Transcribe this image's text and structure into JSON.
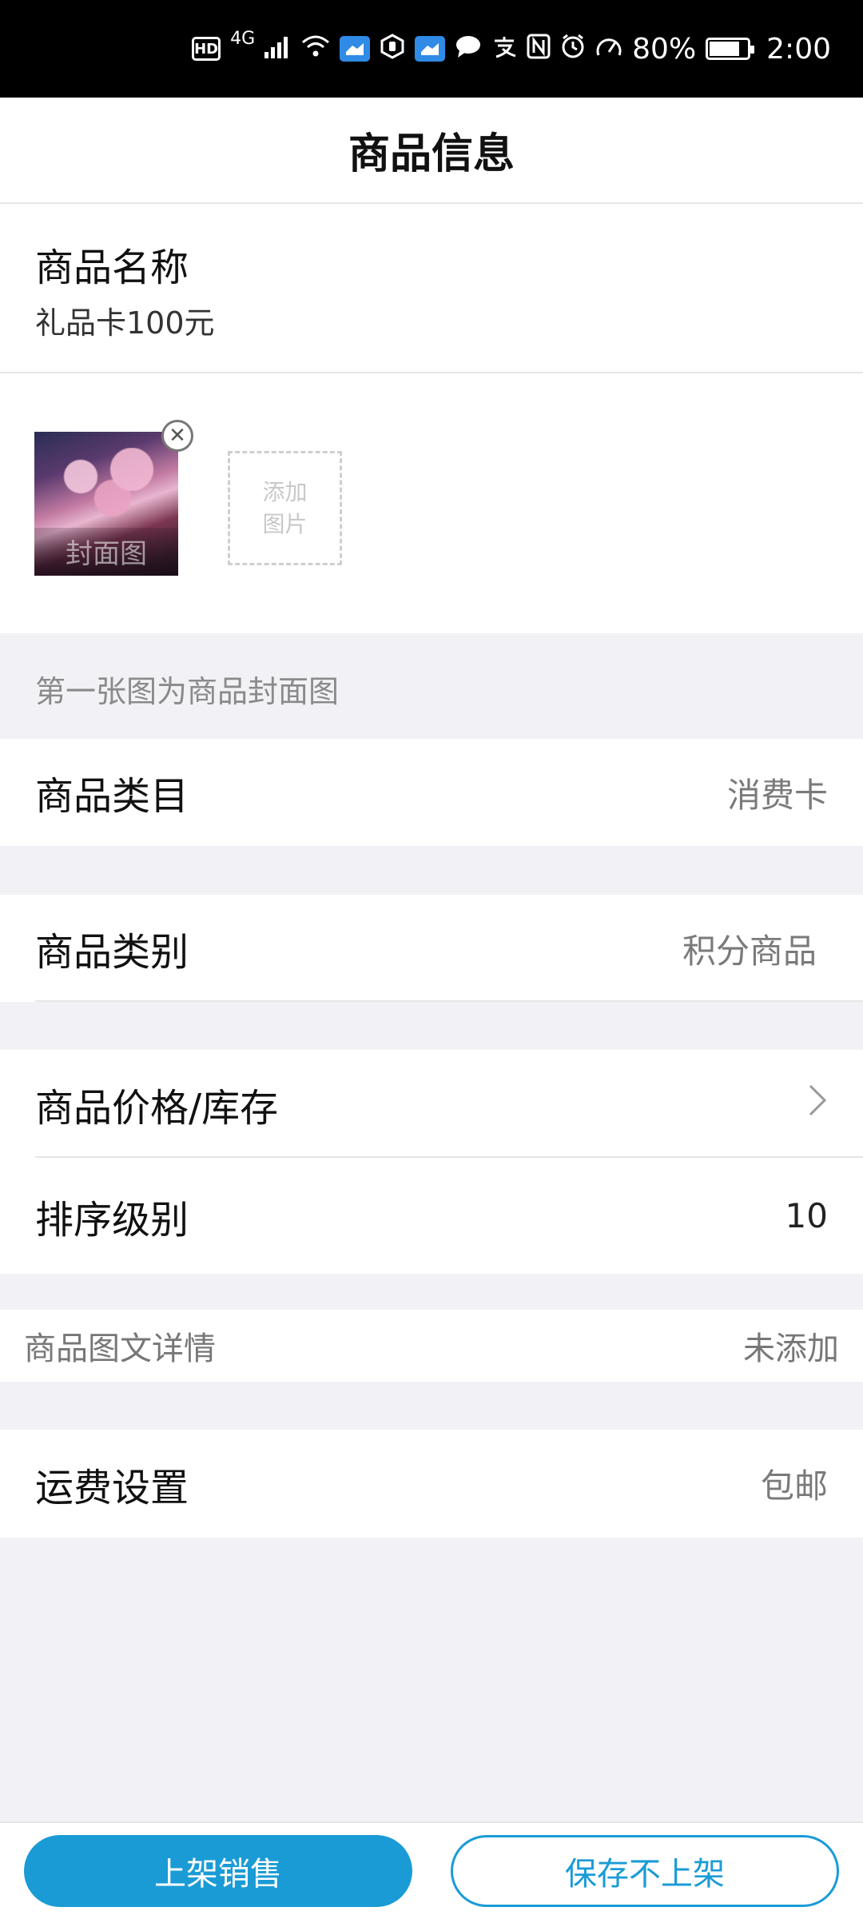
{
  "status_bar": {
    "hd": "HD",
    "network": "4G",
    "battery_percent": "80%",
    "battery_level": 0.8,
    "time": "2:00"
  },
  "nav": {
    "title": "商品信息"
  },
  "product_name": {
    "label": "商品名称",
    "value": "礼品卡100元"
  },
  "images": {
    "cover_caption": "封面图",
    "remove_icon": "close-circle-icon",
    "add_line1": "添加",
    "add_line2": "图片",
    "hint": "第一张图为商品封面图"
  },
  "fields": {
    "category": {
      "label": "商品类目",
      "value": "消费卡"
    },
    "type": {
      "label": "商品类别",
      "value": "积分商品"
    },
    "price_stock": {
      "label": "商品价格/库存",
      "icon": "chevron-right-icon"
    },
    "sort_level": {
      "label": "排序级别",
      "value": "10"
    },
    "detail": {
      "label": "商品图文详情",
      "value": "未添加"
    },
    "shipping": {
      "label": "运费设置",
      "value": "包邮"
    }
  },
  "actions": {
    "publish": "上架销售",
    "save_only": "保存不上架"
  },
  "colors": {
    "accent": "#1a9bd6",
    "background": "#f2f2f6"
  }
}
